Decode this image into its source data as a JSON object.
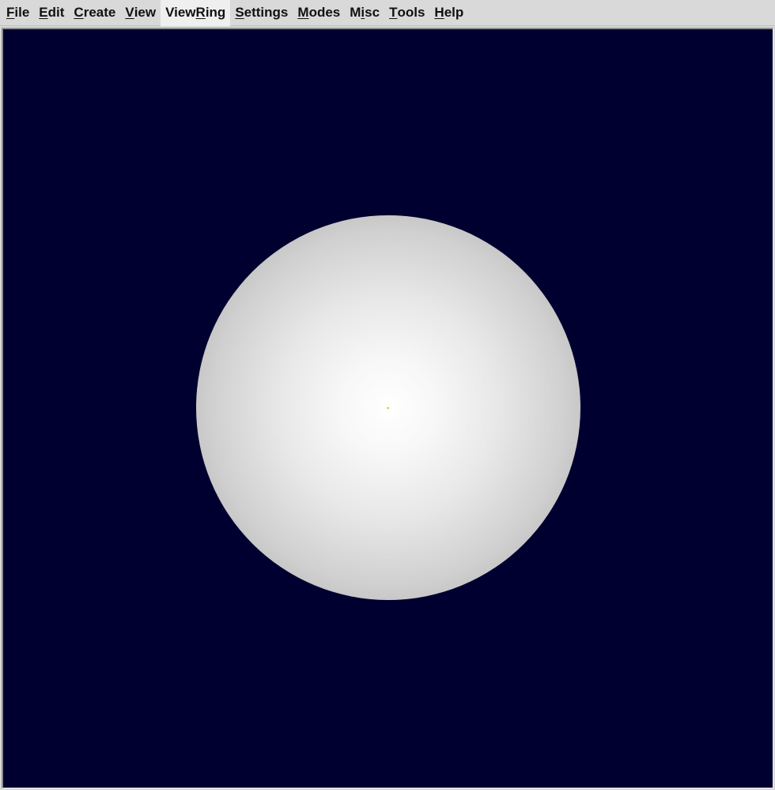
{
  "menubar": {
    "items": [
      {
        "key": "file",
        "before": "",
        "mnemonic": "F",
        "after": "ile"
      },
      {
        "key": "edit",
        "before": "",
        "mnemonic": "E",
        "after": "dit"
      },
      {
        "key": "create",
        "before": "",
        "mnemonic": "C",
        "after": "reate"
      },
      {
        "key": "view",
        "before": "",
        "mnemonic": "V",
        "after": "iew"
      },
      {
        "key": "viewring",
        "before": "View",
        "mnemonic": "R",
        "after": "ing"
      },
      {
        "key": "settings",
        "before": "",
        "mnemonic": "S",
        "after": "ettings"
      },
      {
        "key": "modes",
        "before": "",
        "mnemonic": "M",
        "after": "odes"
      },
      {
        "key": "misc",
        "before": "M",
        "mnemonic": "i",
        "after": "sc"
      },
      {
        "key": "tools",
        "before": "",
        "mnemonic": "T",
        "after": "ools"
      },
      {
        "key": "help",
        "before": "",
        "mnemonic": "H",
        "after": "elp"
      }
    ],
    "active": "viewring"
  },
  "viewport": {
    "background_color": "#000030",
    "object": "sphere",
    "sphere_highlight_color": "#ffffff",
    "sphere_edge_color": "#9a9a9a",
    "center_marker_color": "#d8d84a"
  }
}
